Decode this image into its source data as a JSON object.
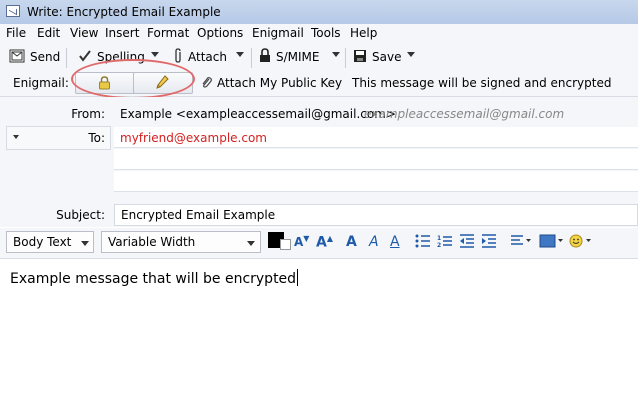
{
  "window": {
    "title": "Write: Encrypted Email Example"
  },
  "menu": [
    {
      "label": "File"
    },
    {
      "label": "Edit"
    },
    {
      "label": "View"
    },
    {
      "label": "Insert"
    },
    {
      "label": "Format"
    },
    {
      "label": "Options"
    },
    {
      "label": "Enigmail"
    },
    {
      "label": "Tools"
    },
    {
      "label": "Help"
    }
  ],
  "toolbar": {
    "send": "Send",
    "spelling": "Spelling",
    "attach": "Attach",
    "smime": "S/MIME",
    "save": "Save"
  },
  "enigmail": {
    "label": "Enigmail:",
    "attach_key": "Attach My Public Key",
    "status": "This message will be signed and encrypted"
  },
  "headers": {
    "from_label": "From:",
    "from_value": "Example <exampleaccessemail@gmail.com>",
    "from_hint": "exampleaccessemail@gmail.com",
    "to_label": "To:",
    "to_value": "myfriend@example.com",
    "subject_label": "Subject:",
    "subject_value": "Encrypted Email Example"
  },
  "format": {
    "paragraph": "Body Text",
    "font": "Variable Width"
  },
  "body": {
    "text": "Example message that will be encrypted"
  },
  "colors": {
    "recipient": "#d42020",
    "highlight_oval": "#e06a6a",
    "accent": "#1f5aa8"
  }
}
